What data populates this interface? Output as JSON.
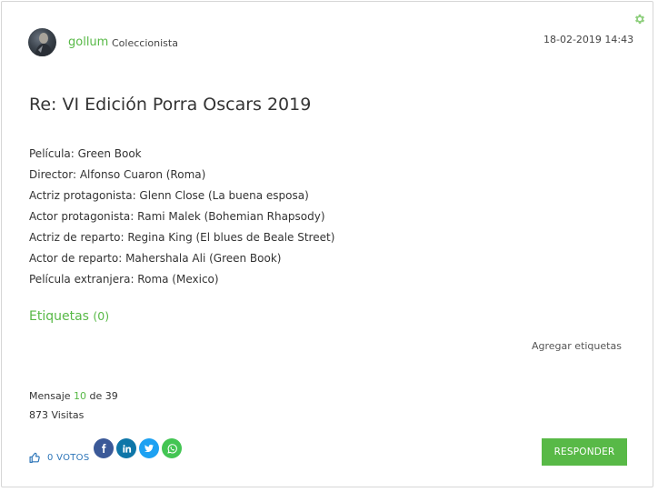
{
  "post": {
    "author": {
      "name": "gollum",
      "rank": "Coleccionista"
    },
    "date": "18-02-2019 14:43",
    "title": "Re: VI Edición Porra Oscars 2019",
    "lines": [
      "Película: Green Book",
      "Director: Alfonso Cuaron (Roma)",
      "Actriz protagonista: Glenn Close (La buena esposa)",
      "Actor protagonista: Rami Malek (Bohemian Rhapsody)",
      "Actriz de reparto: Regina King (El blues de Beale Street)",
      "Actor de reparto: Mahershala Ali (Green Book)",
      "Película extranjera: Roma (Mexico)"
    ]
  },
  "tags": {
    "heading": "Etiquetas",
    "count": "(0)",
    "add_label": "Agregar etiquetas"
  },
  "stats": {
    "message_prefix": "Mensaje",
    "message_number": "10",
    "message_of": "de 39",
    "views": "873 Visitas"
  },
  "votes": {
    "label": "0 VOTOS"
  },
  "social_icons": [
    "facebook-icon",
    "linkedin-icon",
    "twitter-icon",
    "whatsapp-icon"
  ],
  "reply_button": "RESPONDER",
  "colors": {
    "accent": "#58b947",
    "link": "#2e76b9",
    "facebook": "#3b5998",
    "linkedin": "#0e76a8",
    "twitter": "#1da1f2",
    "whatsapp": "#43c553"
  }
}
